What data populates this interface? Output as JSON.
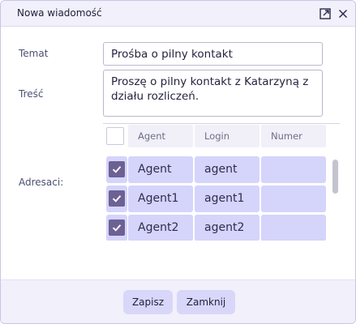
{
  "window": {
    "title": "Nowa wiadomość"
  },
  "icons": {
    "popout": "popout-icon",
    "close": "close-icon",
    "check": "check-icon"
  },
  "form": {
    "subject_label": "Temat",
    "subject_value": "Prośba o pilny kontakt",
    "body_label": "Treść",
    "body_value": "Proszę o pilny kontakt z Katarzyną z działu rozliczeń.",
    "recipients_label": "Adresaci:"
  },
  "grid": {
    "columns": [
      "Agent",
      "Login",
      "Numer"
    ],
    "rows": [
      {
        "checked": true,
        "agent": "Agent",
        "login": "agent",
        "number": ""
      },
      {
        "checked": true,
        "agent": "Agent1",
        "login": "agent1",
        "number": ""
      },
      {
        "checked": true,
        "agent": "Agent2",
        "login": "agent2",
        "number": ""
      }
    ]
  },
  "buttons": {
    "save": "Zapisz",
    "close": "Zamknij"
  },
  "colors": {
    "accent": "#6d6194",
    "row_bg": "#d5d4fb",
    "button_bg": "#d8d7fa",
    "titlebar_bg": "#f1f0fb"
  }
}
